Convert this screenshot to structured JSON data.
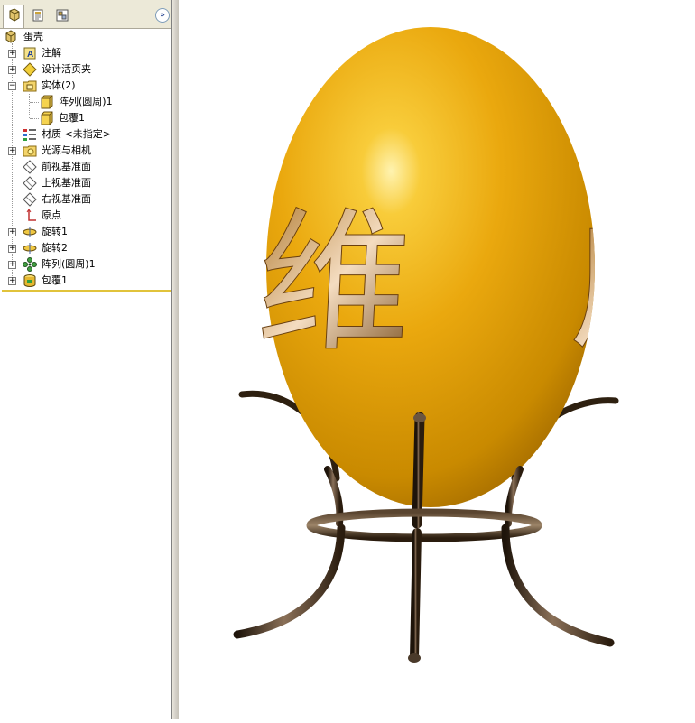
{
  "feature_tree": {
    "root": {
      "label": "蛋壳",
      "icon": "part-icon"
    },
    "items": [
      {
        "label": "注解",
        "icon": "annotation-icon",
        "expander": "+"
      },
      {
        "label": "设计活页夹",
        "icon": "design-binder-icon",
        "expander": "+"
      },
      {
        "label": "实体(2)",
        "icon": "solid-bodies-folder-icon",
        "expander": "−"
      },
      {
        "label": "阵列(圆周)1",
        "icon": "solid-body-icon"
      },
      {
        "label": "包覆1",
        "icon": "solid-body-icon"
      },
      {
        "label": "材质 <未指定>",
        "icon": "material-icon"
      },
      {
        "label": "光源与相机",
        "icon": "lights-cameras-icon",
        "expander": "+"
      },
      {
        "label": "前视基准面",
        "icon": "plane-icon"
      },
      {
        "label": "上视基准面",
        "icon": "plane-icon"
      },
      {
        "label": "右视基准面",
        "icon": "plane-icon"
      },
      {
        "label": "原点",
        "icon": "origin-icon"
      },
      {
        "label": "旋转1",
        "icon": "revolve-icon",
        "expander": "+"
      },
      {
        "label": "旋转2",
        "icon": "revolve-icon",
        "expander": "+"
      },
      {
        "label": "阵列(圆周)1",
        "icon": "circular-pattern-icon",
        "expander": "+"
      },
      {
        "label": "包覆1",
        "icon": "wrap-icon",
        "expander": "+"
      }
    ]
  },
  "tabs": [
    {
      "name": "feature-manager-tab",
      "icon": "feature-manager-icon",
      "active": true
    },
    {
      "name": "property-manager-tab",
      "icon": "property-manager-icon",
      "active": false
    },
    {
      "name": "configuration-manager-tab",
      "icon": "configuration-manager-icon",
      "active": false
    }
  ],
  "expand_button": "»",
  "model": {
    "egg_engraving_chars": [
      "维",
      "风"
    ],
    "egg_color": "#e8a810",
    "stand_color": "#3a2a1a"
  }
}
